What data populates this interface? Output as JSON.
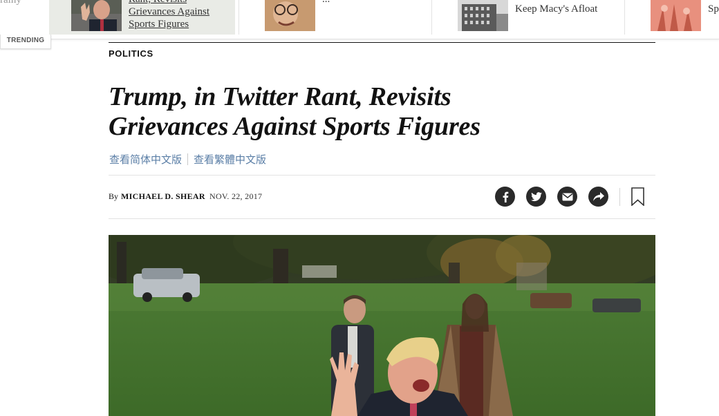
{
  "trending": {
    "label": "TRENDING",
    "edge_text": "rainy",
    "items": [
      {
        "title": "Rant, Revisits Grievances Against Sports Figures",
        "thumb_color": "#8a7f7a",
        "active": true
      },
      {
        "title": "...",
        "thumb_color": "#d8b48c",
        "active": false
      },
      {
        "title": "Keep Macy's Afloat",
        "thumb_color": "#7a7a7a",
        "active": false
      },
      {
        "title": "Sp",
        "thumb_color": "#e07a6a",
        "active": false
      }
    ]
  },
  "article": {
    "section": "POLITICS",
    "headline": "Trump, in Twitter Rant, Revisits Grievances Against Sports Figures",
    "translations": [
      "查看简体中文版",
      "查看繁體中文版"
    ],
    "byline_prefix": "By",
    "author": "MICHAEL D. SHEAR",
    "date": "NOV. 22, 2017",
    "share_icons": [
      "facebook-icon",
      "twitter-icon",
      "email-icon",
      "share-icon"
    ],
    "bookmark_icon": "bookmark-icon"
  },
  "colors": {
    "text": "#121212",
    "translation_link": "#5a7ea6",
    "share_circle": "#2a2a2a",
    "rule": "#e2e2e2"
  }
}
